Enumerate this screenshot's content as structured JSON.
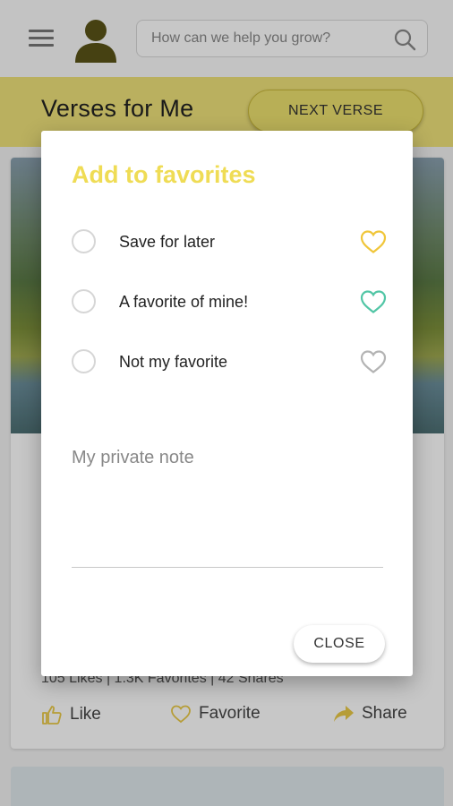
{
  "header": {
    "search_placeholder": "How can we help you grow?"
  },
  "band": {
    "title": "Verses for Me",
    "next_label": "NEXT VERSE"
  },
  "card": {
    "stats": "105 Likes  |  1.3K Favorites  |  42 Shares",
    "like_label": "Like",
    "favorite_label": "Favorite",
    "share_label": "Share"
  },
  "dialog": {
    "title": "Add to favorites",
    "options": [
      {
        "label": "Save for later",
        "heart_color": "#f0c63a"
      },
      {
        "label": "A favorite of mine!",
        "heart_color": "#52c6a6"
      },
      {
        "label": "Not my favorite",
        "heart_color": "#b4b4b4"
      }
    ],
    "note_placeholder": "My private note",
    "close_label": "CLOSE"
  },
  "colors": {
    "accent_yellow": "#efe27a",
    "title_yellow": "#efdc55",
    "action_icon": "#e9c947"
  },
  "icons": [
    "menu-icon",
    "avatar-icon",
    "search-icon",
    "thumbs-up-icon",
    "heart-icon",
    "share-arrow-icon"
  ]
}
